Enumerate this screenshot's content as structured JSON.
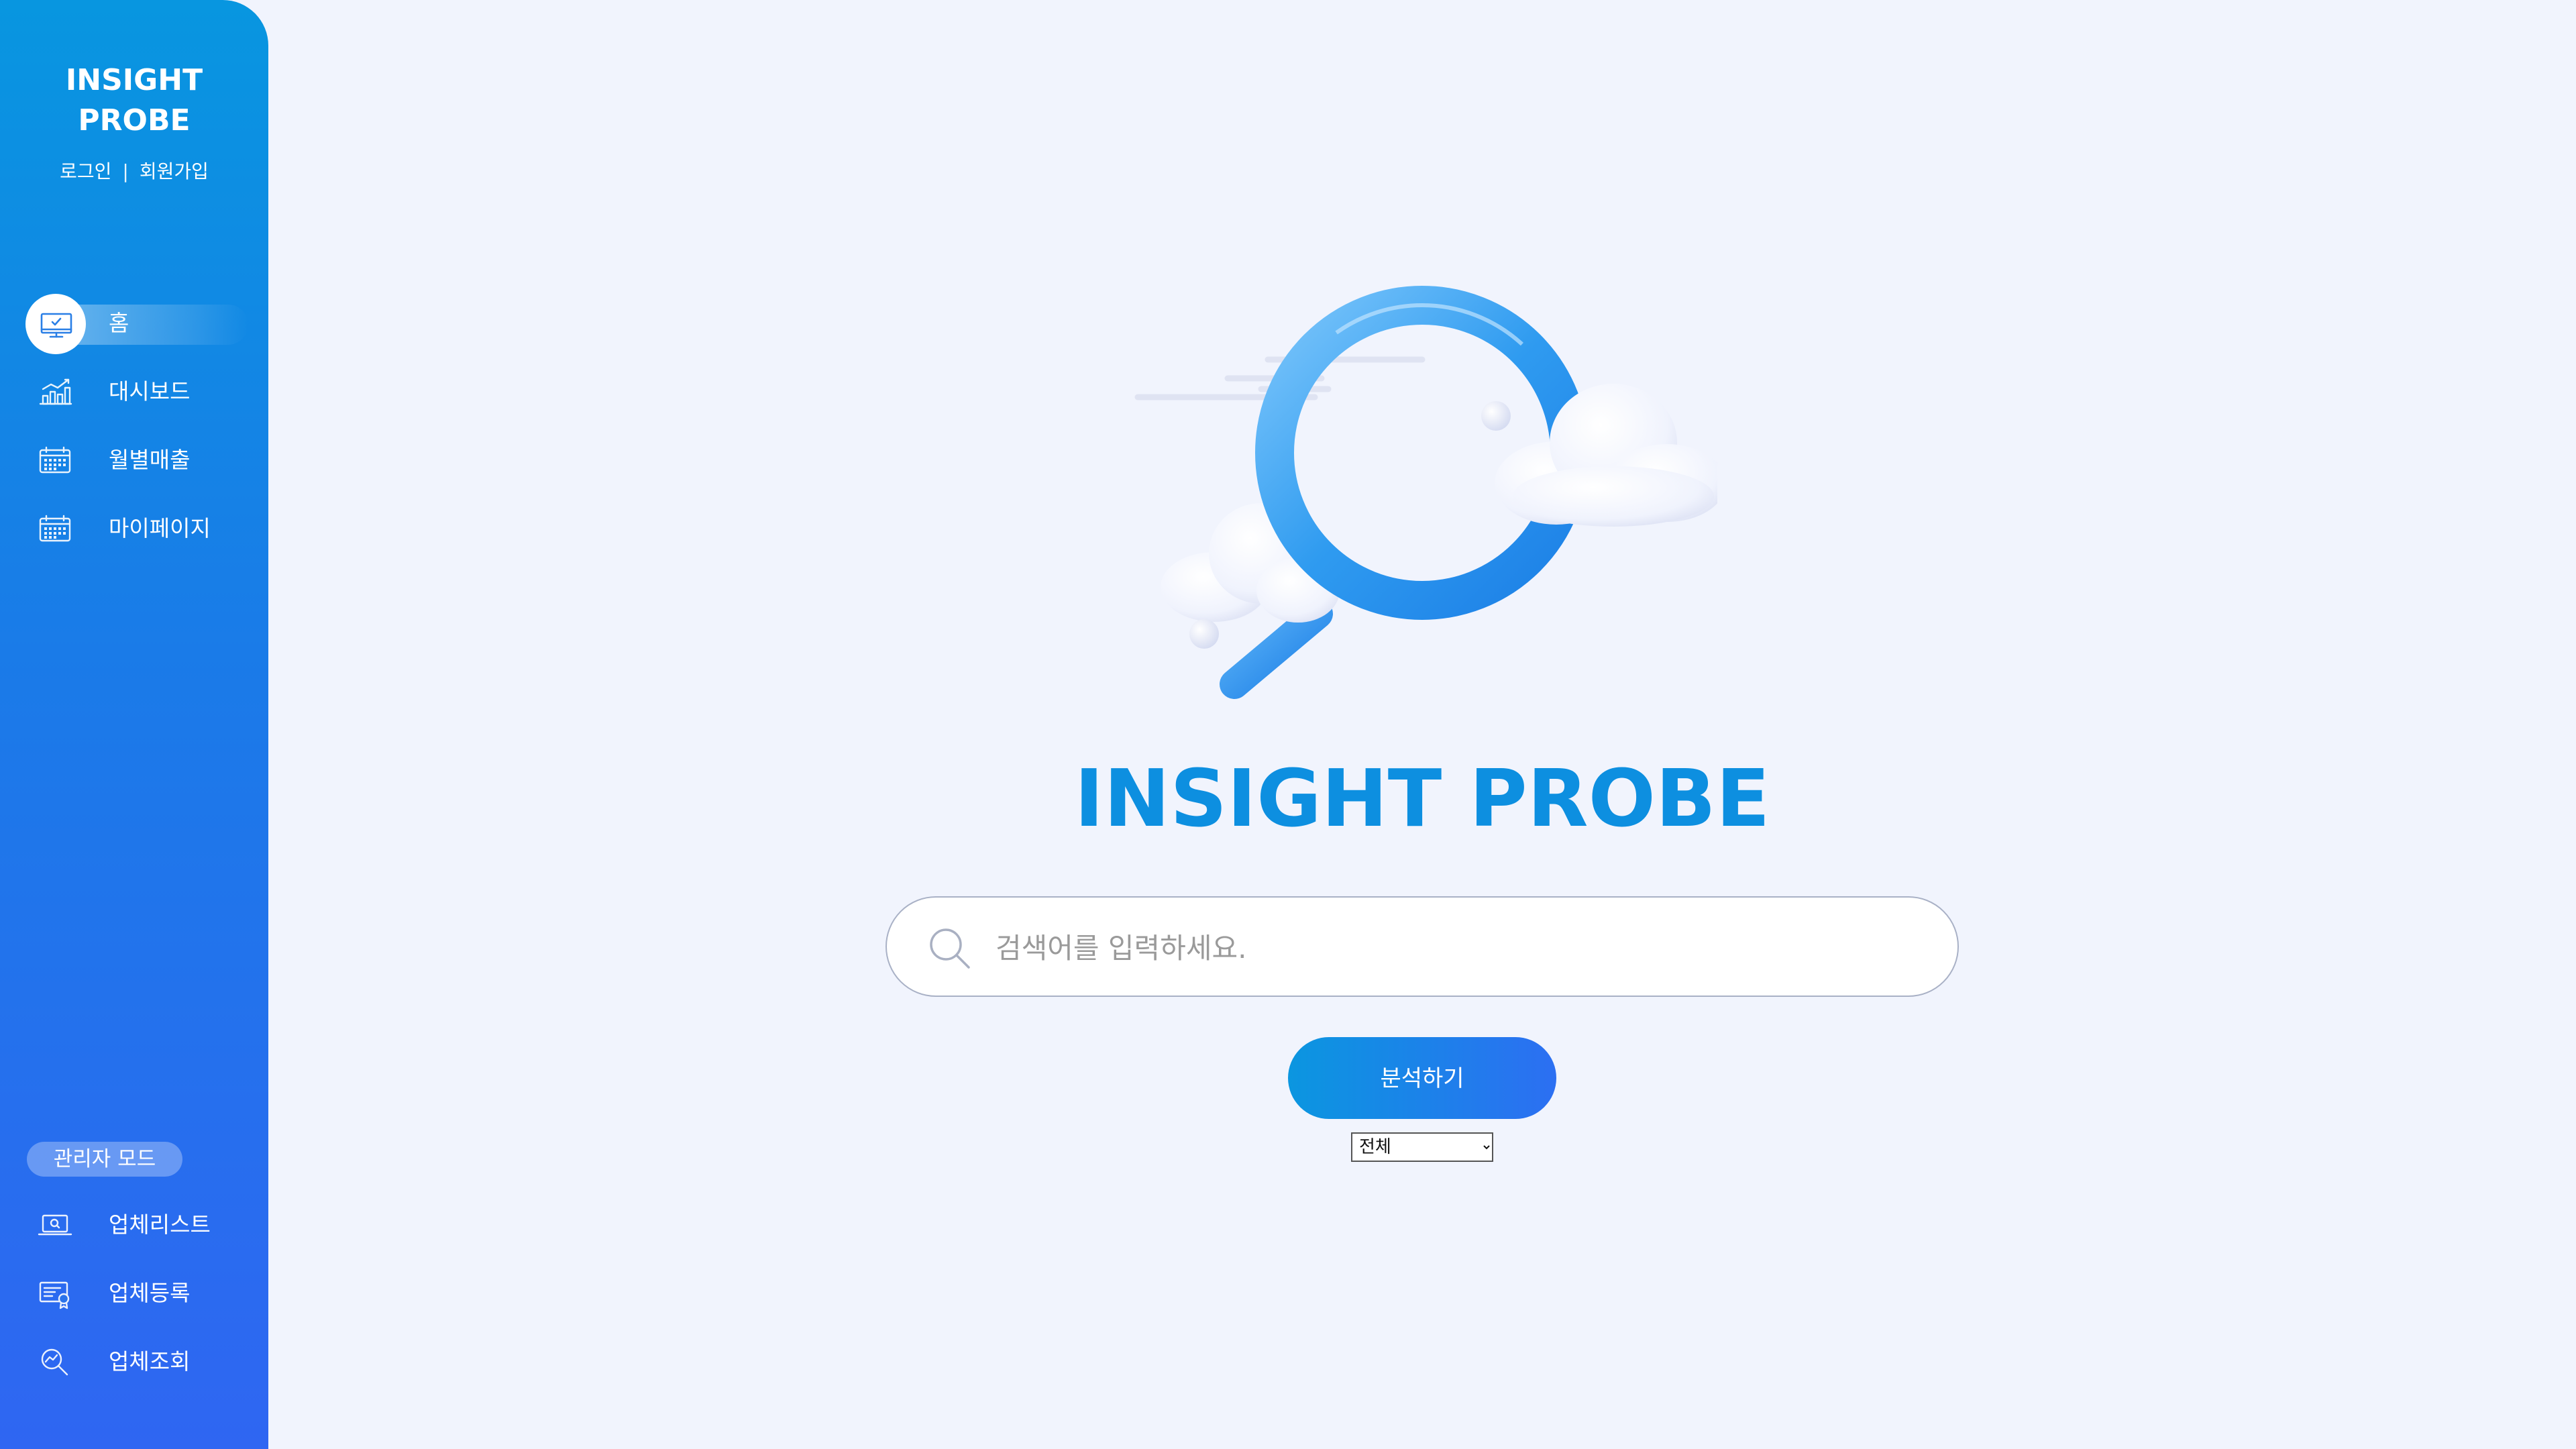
{
  "sidebar": {
    "brand_line1": "INSIGHT",
    "brand_line2": "PROBE",
    "login_label": "로그인",
    "separator": "|",
    "signup_label": "회원가입",
    "nav_items": [
      {
        "label": "홈",
        "icon": "monitor-check-icon",
        "active": true
      },
      {
        "label": "대시보드",
        "icon": "bar-chart-icon"
      },
      {
        "label": "월별매출",
        "icon": "calendar-icon"
      },
      {
        "label": "마이페이지",
        "icon": "calendar-icon"
      }
    ],
    "admin_mode_label": "관리자 모드",
    "admin_items": [
      {
        "label": "업체리스트",
        "icon": "laptop-search-icon"
      },
      {
        "label": "업체등록",
        "icon": "certificate-icon"
      },
      {
        "label": "업체조회",
        "icon": "chart-search-icon"
      }
    ]
  },
  "main": {
    "title": "INSIGHT PROBE",
    "search": {
      "placeholder": "검색어를 입력하세요.",
      "value": "",
      "icon": "search-icon"
    },
    "analyze_button_label": "분석하기",
    "scope_select": {
      "selected": "전체"
    },
    "hero_icon": "magnifier-clouds-illustration"
  },
  "colors": {
    "sidebar_top": "#0896e0",
    "sidebar_bottom": "#2f66f2",
    "title": "#0d8fe0",
    "background": "#f1f4fd"
  }
}
